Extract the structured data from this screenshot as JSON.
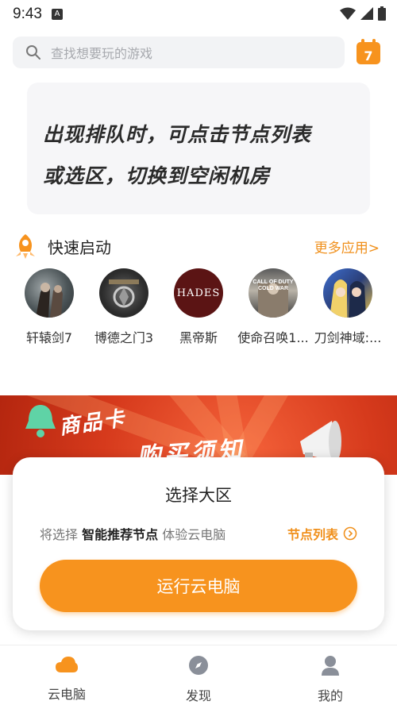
{
  "status": {
    "time": "9:43",
    "notif": "A"
  },
  "search": {
    "placeholder": "查找想要玩的游戏",
    "calendar_day": "7"
  },
  "notice": {
    "line1": "出现排队时，可点击节点列表",
    "line2": "或选区，切换到空闲机房"
  },
  "quick": {
    "title": "快速启动",
    "more": "更多应用>",
    "apps": [
      {
        "label": "轩辕剑7"
      },
      {
        "label": "博德之门3"
      },
      {
        "label": "黑帝斯",
        "logo": "HADES"
      },
      {
        "label": "使命召唤1...",
        "logo": "CALL OF DUTY COLD WAR"
      },
      {
        "label": "刀剑神域:..."
      }
    ]
  },
  "banner": {
    "line1": "商品卡",
    "line2": "购买须知"
  },
  "region": {
    "title": "选择大区",
    "prefix": "将选择",
    "node": "智能推荐节点",
    "suffix": "体验云电脑",
    "node_list": "节点列表",
    "run": "运行云电脑"
  },
  "tabs": [
    {
      "label": "云电脑",
      "icon": "cloud-icon"
    },
    {
      "label": "发现",
      "icon": "compass-icon"
    },
    {
      "label": "我的",
      "icon": "user-icon"
    }
  ],
  "colors": {
    "accent": "#f7931e",
    "banner": "#d63a1c"
  }
}
